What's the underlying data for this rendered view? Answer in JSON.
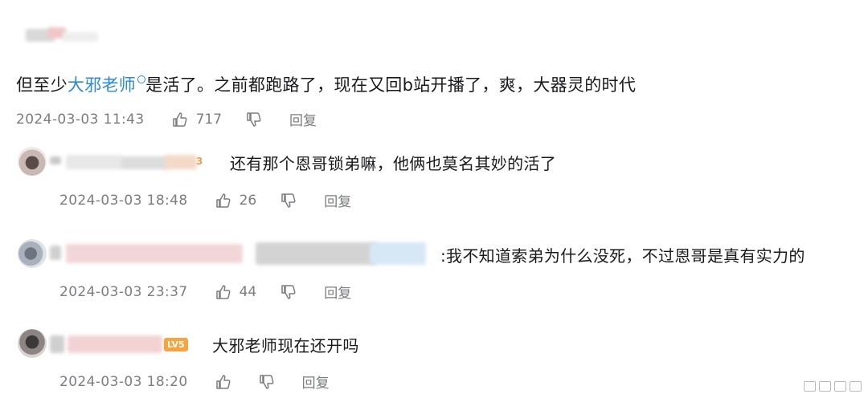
{
  "comment_main": {
    "text_before": "但至少",
    "mention": "大邪老师",
    "text_after": "是活了。之前都跑路了，现在又回b站开播了，爽，大器灵的时代",
    "date": "2024-03-03 11:43",
    "likes": "717",
    "reply_label": "回复"
  },
  "replies": [
    {
      "text": "还有那个恩哥锁弟嘛，他俩也莫名其妙的活了",
      "date": "2024-03-03 18:48",
      "likes": "26",
      "reply_label": "回复"
    },
    {
      "text": ":我不知道索弟为什么没死，不过恩哥是真有实力的",
      "date": "2024-03-03 23:37",
      "likes": "44",
      "reply_label": "回复"
    },
    {
      "text": "大邪老师现在还开吗",
      "date": "2024-03-03 18:20",
      "likes": "",
      "reply_label": "回复",
      "level_badge": "LV5"
    }
  ],
  "icons": {
    "like": "thumbs-up-icon",
    "dislike": "thumbs-down-icon",
    "mention": "search-mention-icon"
  },
  "colors": {
    "mention": "#2b8ad8",
    "meta_text": "#7a7d82",
    "level_badge": "#f7a43f"
  }
}
